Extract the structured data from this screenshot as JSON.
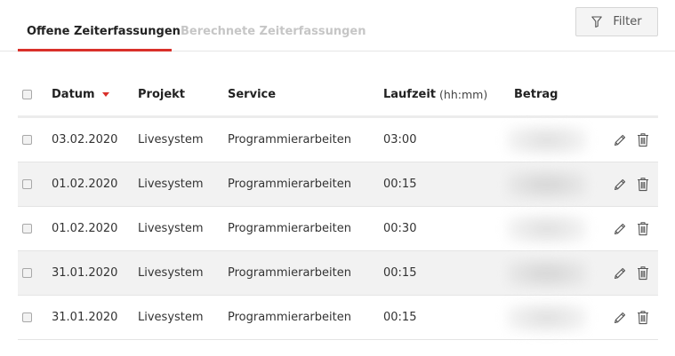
{
  "tabs": [
    {
      "label": "Offene Zeiterfassungen",
      "active": true
    },
    {
      "label": "Berechnete Zeiterfassungen",
      "active": false
    }
  ],
  "filter": {
    "label": "Filter",
    "icon": "filter-icon"
  },
  "table": {
    "columns": {
      "date": "Datum",
      "project": "Projekt",
      "service": "Service",
      "duration": "Laufzeit",
      "duration_unit": "(hh:mm)",
      "amount": "Betrag"
    },
    "sort": {
      "column": "date",
      "direction": "desc"
    },
    "rows": [
      {
        "date": "03.02.2020",
        "project": "Livesystem",
        "service": "Programmierarbeiten",
        "duration": "03:00"
      },
      {
        "date": "01.02.2020",
        "project": "Livesystem",
        "service": "Programmierarbeiten",
        "duration": "00:15"
      },
      {
        "date": "01.02.2020",
        "project": "Livesystem",
        "service": "Programmierarbeiten",
        "duration": "00:30"
      },
      {
        "date": "31.01.2020",
        "project": "Livesystem",
        "service": "Programmierarbeiten",
        "duration": "00:15"
      },
      {
        "date": "31.01.2020",
        "project": "Livesystem",
        "service": "Programmierarbeiten",
        "duration": "00:15"
      }
    ],
    "row_actions": [
      "edit-icon",
      "trash-icon"
    ]
  },
  "colors": {
    "accent": "#d9302a",
    "row_alt": "#f2f2f2",
    "inactive_tab": "#c6c6c6"
  }
}
